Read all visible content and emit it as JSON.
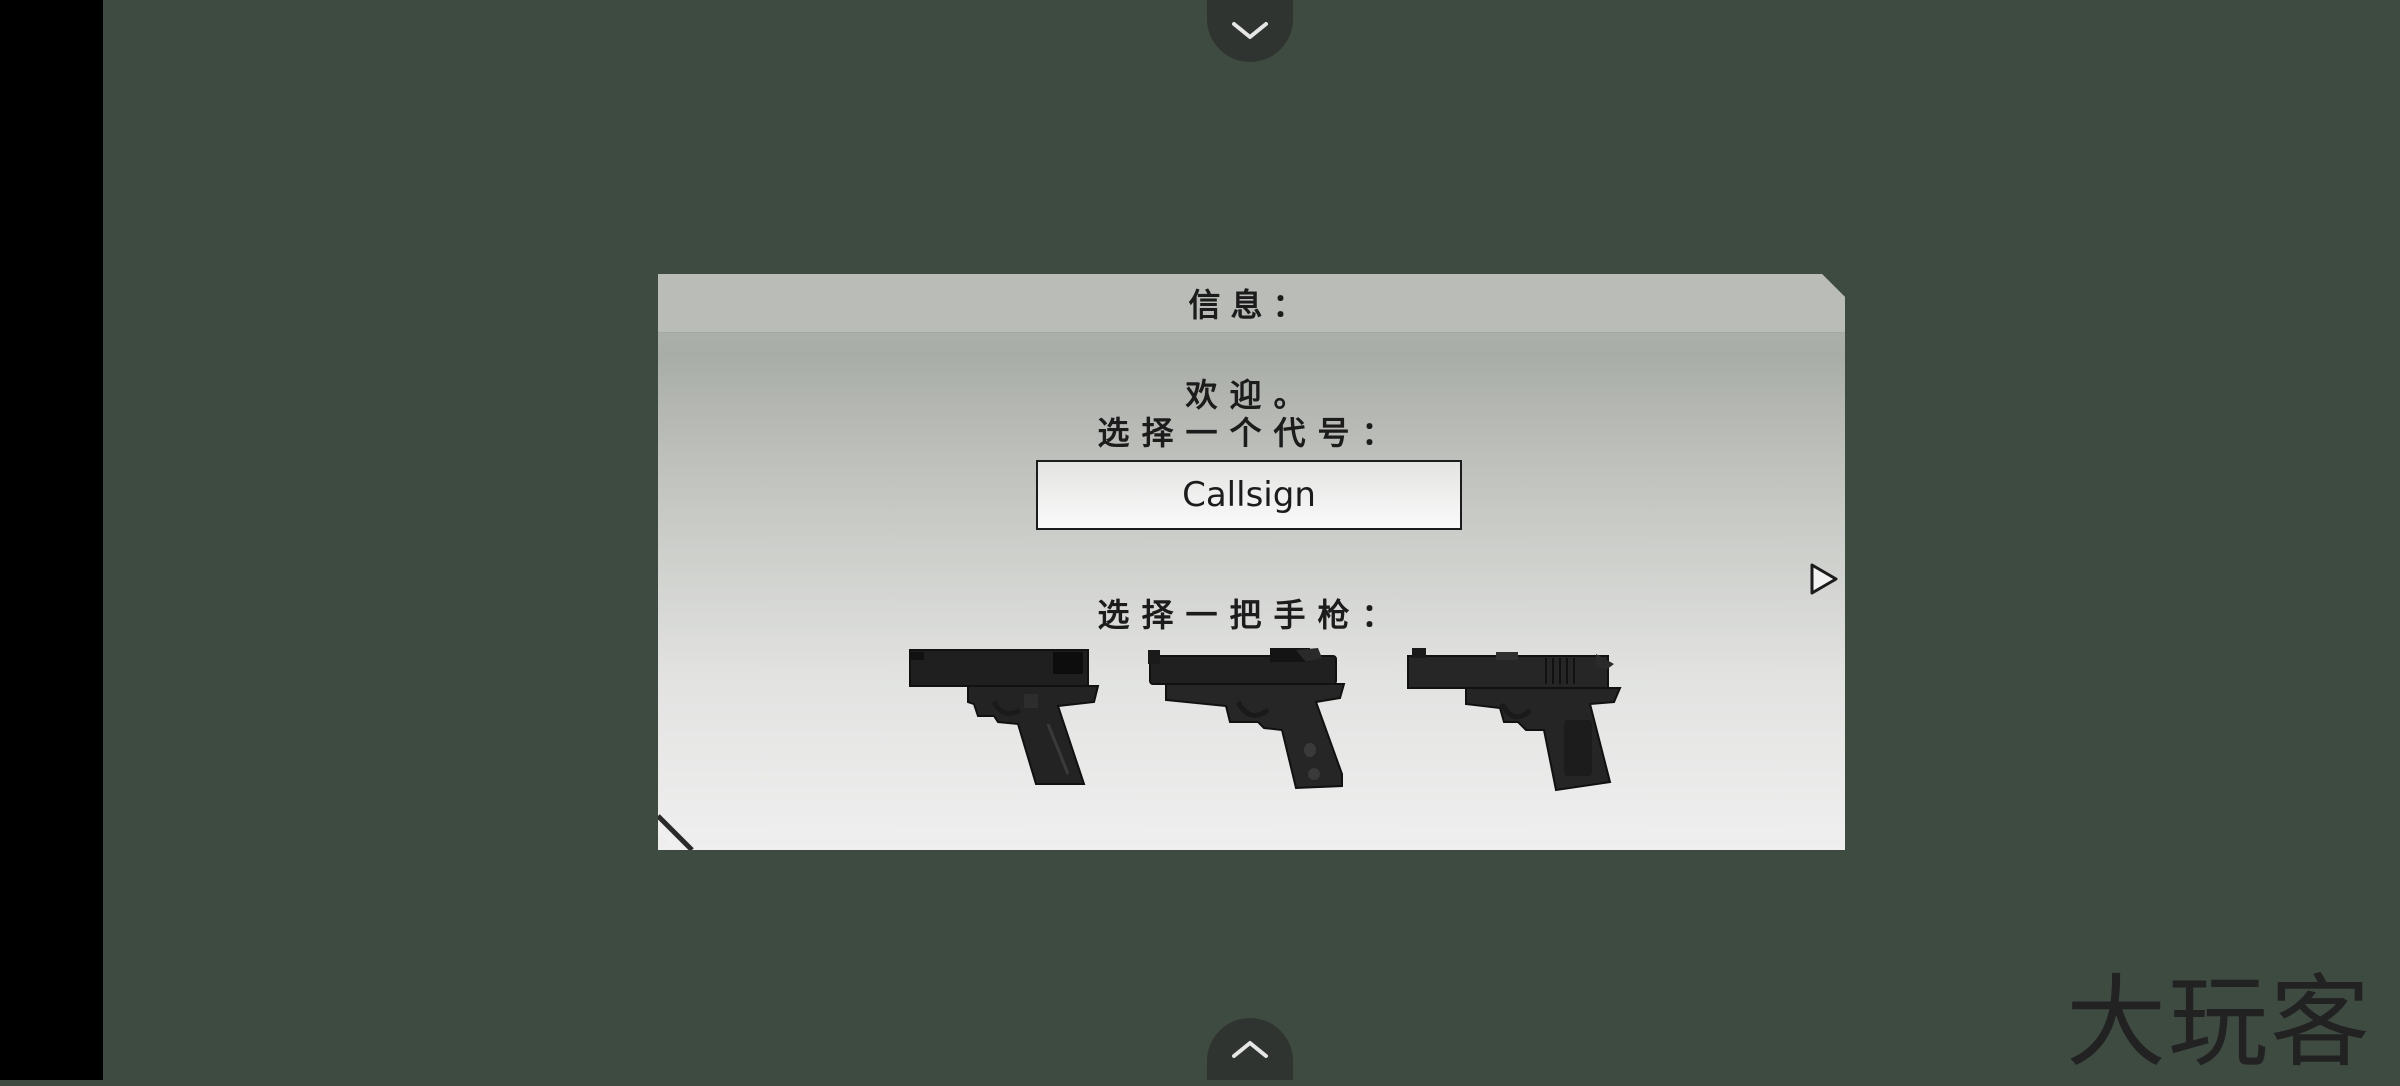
{
  "dialog": {
    "title": "信息：",
    "welcome_text": "欢迎。",
    "callsign_prompt": "选择一个代号：",
    "callsign_input": {
      "value": "Callsign"
    },
    "pistol_prompt": "选择一把手枪："
  },
  "pistols": [
    {
      "icon": "glock-pistol-icon"
    },
    {
      "icon": "beretta-pistol-icon"
    },
    {
      "icon": "colt-1911-pistol-icon"
    }
  ],
  "watermark": "大玩客",
  "colors": {
    "background": "#3e4b41",
    "dialog_top": "#b2b5b0",
    "dialog_bottom": "#efefef",
    "text": "#1c1c1c"
  }
}
